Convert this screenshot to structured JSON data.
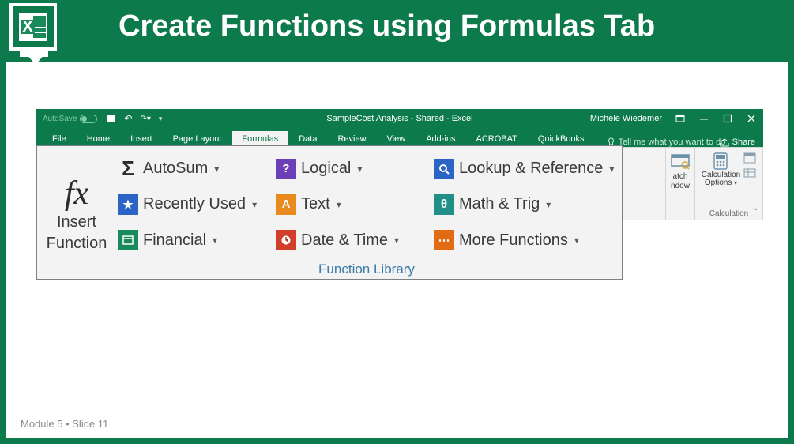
{
  "slide": {
    "title": "Create Functions using Formulas Tab",
    "footer": "Module 5 • Slide 11"
  },
  "excel": {
    "autosave_label": "AutoSave",
    "title": "SampleCost Analysis - Shared - Excel",
    "user": "Michele Wiedemer",
    "share": "Share"
  },
  "tabs": {
    "file": "File",
    "home": "Home",
    "insert": "Insert",
    "page_layout": "Page Layout",
    "formulas": "Formulas",
    "data": "Data",
    "review": "Review",
    "view": "View",
    "addins": "Add-ins",
    "acrobat": "ACROBAT",
    "quickbooks": "QuickBooks",
    "tell_me": "Tell me what you want to do"
  },
  "ribbon_right": {
    "watch1": "atch",
    "watch2": "ndow",
    "calc_label": "Calculation",
    "calc_options": "Options",
    "group_label": "Calculation"
  },
  "function_library": {
    "insert1": "Insert",
    "insert2": "Function",
    "autosum": "AutoSum",
    "recently_used": "Recently Used",
    "financial": "Financial",
    "logical": "Logical",
    "text": "Text",
    "date_time": "Date & Time",
    "lookup": "Lookup & Reference",
    "math_trig": "Math & Trig",
    "more": "More Functions",
    "group_label": "Function Library"
  }
}
